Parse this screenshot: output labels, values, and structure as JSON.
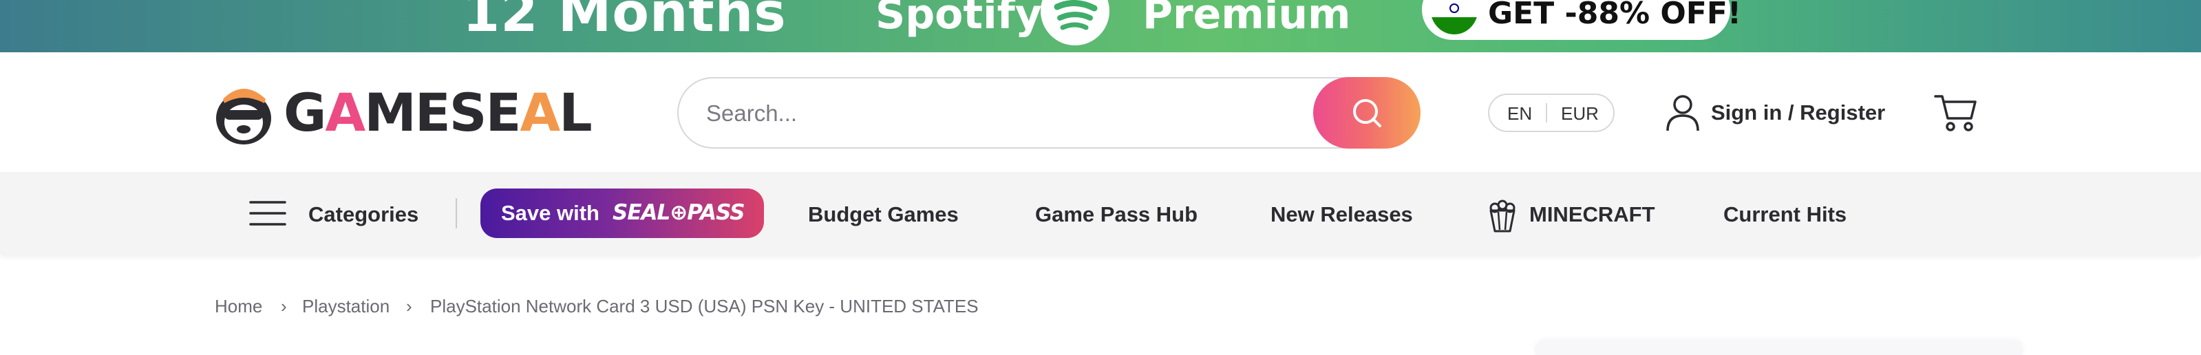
{
  "promo": {
    "months": "12 Months",
    "spotify": "Spotify",
    "premium": "Premium",
    "offer": "GET -88% OFF!"
  },
  "header": {
    "logo_prefix": "G",
    "logo_a": "A",
    "logo_mid": "MESE",
    "logo_a2": "A",
    "logo_suffix": "L",
    "search_placeholder": "Search...",
    "language": "EN",
    "currency": "EUR",
    "signin_label": "Sign in / Register"
  },
  "nav": {
    "categories_label": "Categories",
    "sealpass_label": "Save with",
    "sealpass_brand": "SEAL⊕PASS",
    "items": [
      "Budget Games",
      "Game Pass Hub",
      "New Releases",
      "MINECRAFT",
      "Current Hits"
    ]
  },
  "breadcrumb": {
    "items": [
      "Home",
      "Playstation",
      "PlayStation Network Card 3 USD (USA) PSN Key - UNITED STATES"
    ],
    "separator": "›"
  },
  "colors": {
    "brand_pink": "#ec4c83",
    "brand_orange": "#f3974b",
    "sealpass_start": "#4a1a9e",
    "sealpass_end": "#d9416b",
    "promo_green": "#62c06e"
  }
}
